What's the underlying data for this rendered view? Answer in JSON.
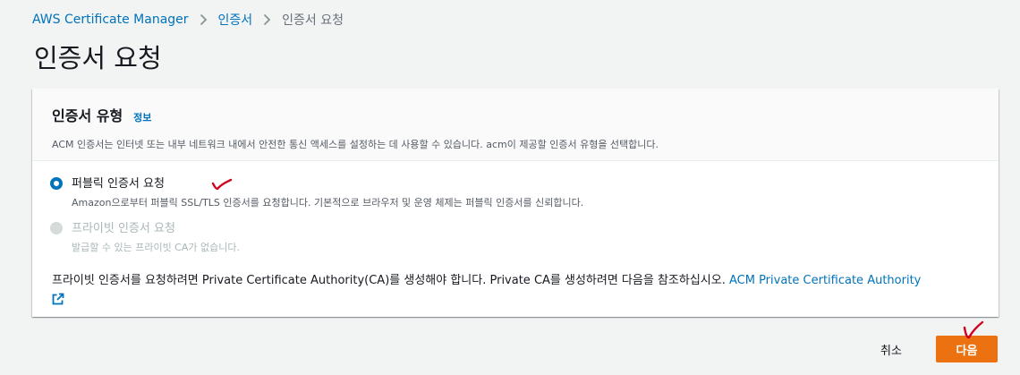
{
  "breadcrumb": {
    "items": [
      "AWS Certificate Manager",
      "인증서",
      "인증서 요청"
    ]
  },
  "page": {
    "title": "인증서 요청"
  },
  "panel": {
    "title": "인증서 유형",
    "info_link": "정보",
    "description": "ACM 인증서는 인터넷 또는 내부 네트워크 내에서 안전한 통신 액세스를 설정하는 데 사용할 수 있습니다. acm이 제공할 인증서 유형을 선택합니다.",
    "options": [
      {
        "label": "퍼블릭 인증서 요청",
        "description": "Amazon으로부터 퍼블릭 SSL/TLS 인증서를 요청합니다. 기본적으로 브라우저 및 운영 체제는 퍼블릭 인증서를 신뢰합니다.",
        "selected": true,
        "disabled": false
      },
      {
        "label": "프라이빗 인증서 요청",
        "description": "발급할 수 있는 프라이빗 CA가 없습니다.",
        "selected": false,
        "disabled": true
      }
    ],
    "note_text": "프라이빗 인증서를 요청하려면 Private Certificate Authority(CA)를 생성해야 합니다. Private CA를 생성하려면 다음을 참조하십시오.",
    "note_link": "ACM Private Certificate Authority"
  },
  "actions": {
    "cancel_label": "취소",
    "next_label": "다음"
  },
  "colors": {
    "accent": "#0073bb",
    "primary_button": "#ec7211",
    "annotation": "#d0021b"
  },
  "icons": [
    "chevron-right-icon",
    "external-link-icon",
    "checkmark-annotation-icon"
  ]
}
